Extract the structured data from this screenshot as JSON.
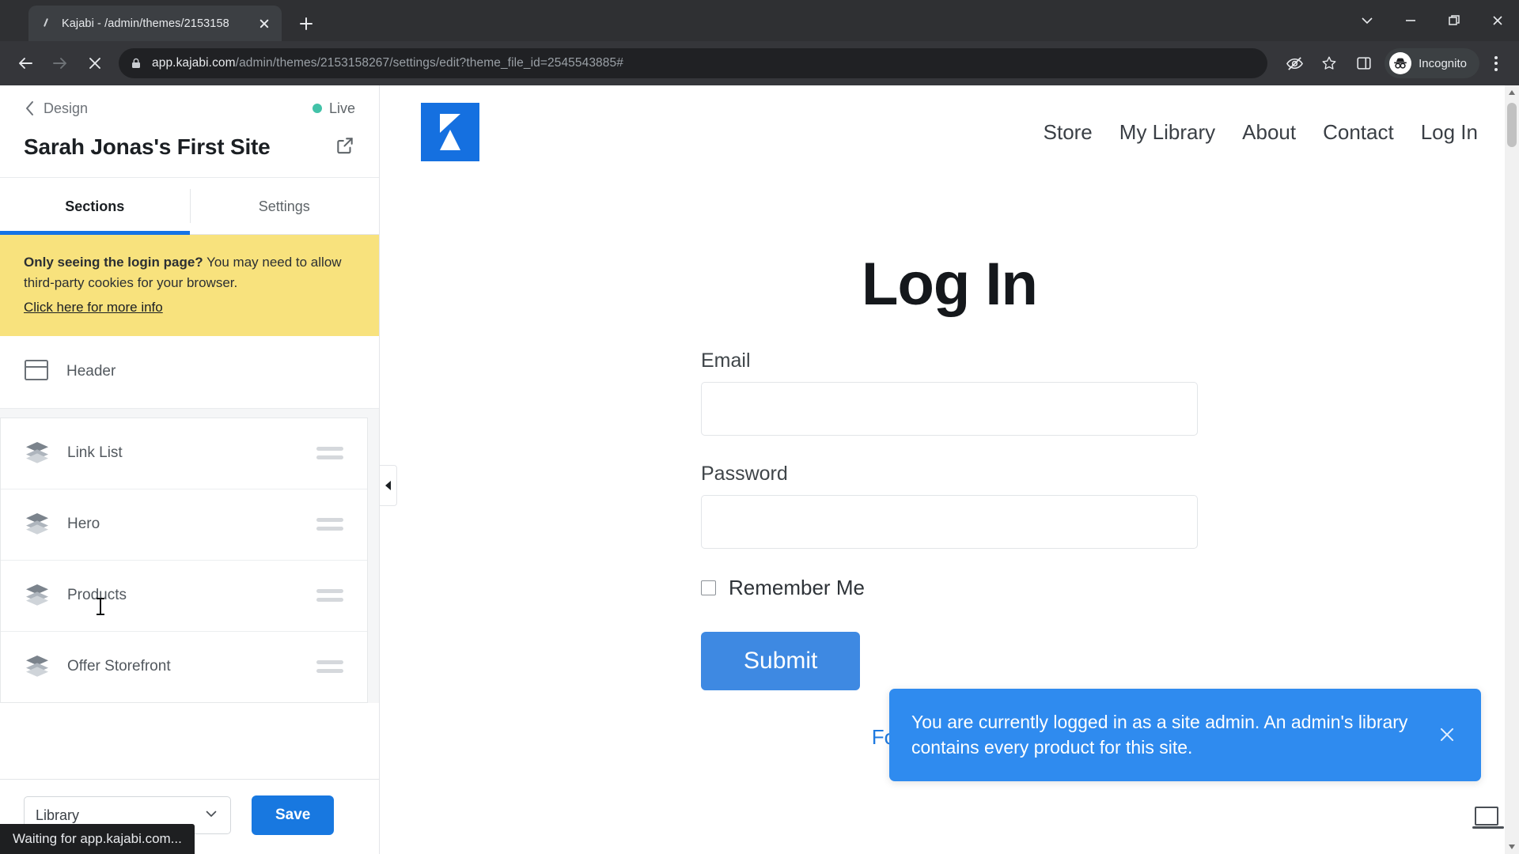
{
  "browser": {
    "tab": {
      "title": "Kajabi - /admin/themes/2153158",
      "favicon_name": "loading-spinner-icon"
    },
    "url_host": "app.kajabi.com",
    "url_path": "/admin/themes/2153158267/settings/edit?theme_file_id=2545543885#",
    "profile_label": "Incognito",
    "status_text": "Waiting for app.kajabi.com...",
    "icons": {
      "back": "back-arrow-icon",
      "forward": "forward-arrow-icon",
      "stop": "stop-loading-icon",
      "lock": "site-security-lock-icon",
      "tracking": "third-party-cookie-blocked-icon",
      "bookmark": "bookmark-star-icon",
      "sidepanel": "side-panel-icon",
      "menu": "chrome-menu-icon",
      "tabsearch": "tab-search-chevron-icon",
      "minimize": "minimize-icon",
      "maximize": "maximize-restore-icon",
      "close": "window-close-icon"
    }
  },
  "editor": {
    "back_label": "Design",
    "status_label": "Live",
    "site_title": "Sarah Jonas's First Site",
    "preview_icon": "open-in-new-tab-icon",
    "tabs": [
      {
        "label": "Sections",
        "active": true
      },
      {
        "label": "Settings",
        "active": false
      }
    ],
    "notice": {
      "bold": "Only seeing the login page?",
      "text": " You may need to allow third-party cookies for your browser.",
      "link": "Click here for more info"
    },
    "header_row": {
      "label": "Header",
      "icon": "header-layout-icon"
    },
    "sections": [
      {
        "label": "Link List",
        "icon": "layers-icon",
        "handle": "drag-handle-icon"
      },
      {
        "label": "Hero",
        "icon": "layers-icon",
        "handle": "drag-handle-icon"
      },
      {
        "label": "Products",
        "icon": "layers-icon",
        "handle": "drag-handle-icon"
      },
      {
        "label": "Offer Storefront",
        "icon": "layers-icon",
        "handle": "drag-handle-icon"
      }
    ],
    "footer": {
      "select_value": "Library",
      "select_icon": "chevron-down-icon",
      "save_label": "Save"
    },
    "collapse_icon": "collapse-panel-left-icon"
  },
  "site": {
    "logo_name": "kajabi-logo-icon",
    "nav": [
      {
        "label": "Store"
      },
      {
        "label": "My Library"
      },
      {
        "label": "About"
      },
      {
        "label": "Contact"
      },
      {
        "label": "Log In"
      }
    ],
    "login": {
      "title": "Log In",
      "email_label": "Email",
      "email_value": "",
      "password_label": "Password",
      "password_value": "",
      "remember_label": "Remember Me",
      "submit_label": "Submit",
      "forgot_label": "Forgot Password"
    },
    "toast": {
      "message": "You are currently logged in as a site admin. An admin's library contains every product for this site.",
      "close_icon": "toast-close-icon",
      "color": "#2f8bef"
    }
  },
  "colors": {
    "accent_blue": "#1878e0",
    "notice_yellow": "#f8e27d",
    "live_green": "#42c2a8",
    "toast_blue": "#2f8bef"
  }
}
